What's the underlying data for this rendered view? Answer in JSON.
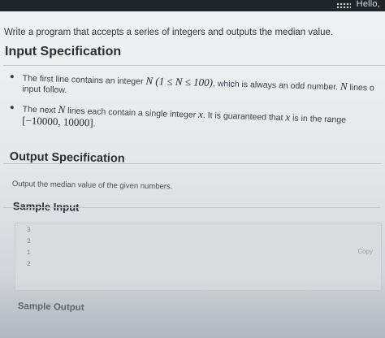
{
  "header": {
    "greeting": "Hello,"
  },
  "problem": {
    "intro": "Write a program that accepts a series of integers and outputs the median value.",
    "input_heading": "Input Specification",
    "bullet1_prefix": "The first line contains an integer",
    "bullet1_math": "N (1 ≤ N ≤ 100)",
    "bullet1_middle": ", which is always an odd number.",
    "bullet1_math2": "N",
    "bullet1_suffix": "lines o",
    "bullet1_cont": "input follow.",
    "bullet2_prefix": "The next",
    "bullet2_math": "N",
    "bullet2_middle": "lines each contain a single integer",
    "bullet2_math2": "x",
    "bullet2_suffix": ". It is guaranteed that",
    "bullet2_math3": "x",
    "bullet2_tail": "is in the range",
    "bullet2_range": "[−10000, 10000]",
    "bullet2_end": ".",
    "output_heading": "Output Specification",
    "output_text": "Output the median value of the given numbers.",
    "sample_input_heading": "Sample Input",
    "sample_input_lines": [
      "3",
      "3",
      "1",
      "2"
    ],
    "copy_label": "Copy",
    "sample_output_heading": "Sample Output"
  },
  "colors": {
    "topbar": "#20242b",
    "heading": "#2a2e35",
    "body_text": "#3a3f47",
    "code_bg": "#d9dcdf"
  }
}
